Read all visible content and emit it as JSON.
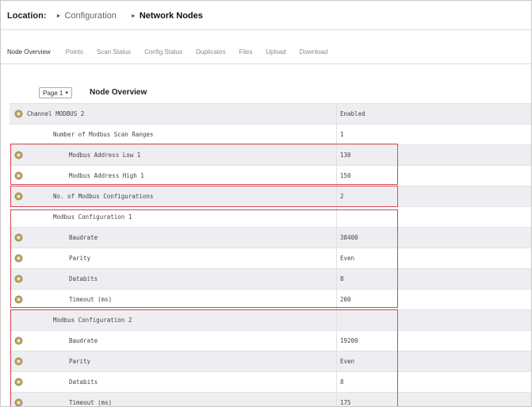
{
  "location": {
    "label": "Location:",
    "crumbs": [
      "Configuration",
      "Network Nodes"
    ]
  },
  "tabs": [
    "Node Overview",
    "Points",
    "Scan Status",
    "Config Status",
    "Duplicates",
    "Files",
    "Upload",
    "Download"
  ],
  "page_select": {
    "value": "Page 1"
  },
  "page_title": "Node Overview",
  "rows": [
    {
      "name": "Channel MODBUS 2",
      "value": "Enabled",
      "indent": 0,
      "icon": "gear-icon"
    },
    {
      "name": "Number of Modbus Scan Ranges",
      "value": "1",
      "indent": 1,
      "icon": ""
    },
    {
      "name": "Modbus Address Low 1",
      "value": "130",
      "indent": 2,
      "icon": "gear-icon"
    },
    {
      "name": "Modbus Address High 1",
      "value": "150",
      "indent": 2,
      "icon": "gear-icon"
    },
    {
      "name": "No. of Modbus Configurations",
      "value": "2",
      "indent": 1,
      "icon": "gear-icon"
    },
    {
      "name": "Modbus Configuration 1",
      "value": "",
      "indent": 1,
      "icon": ""
    },
    {
      "name": "Baudrate",
      "value": "38400",
      "indent": 2,
      "icon": "gear-icon"
    },
    {
      "name": "Parity",
      "value": "Even",
      "indent": 2,
      "icon": "gear-icon"
    },
    {
      "name": "Databits",
      "value": "8",
      "indent": 2,
      "icon": "gear-icon"
    },
    {
      "name": "Timeout (ms)",
      "value": "200",
      "indent": 2,
      "icon": "gear-icon"
    },
    {
      "name": "Modbus Configuration 2",
      "value": "",
      "indent": 1,
      "icon": ""
    },
    {
      "name": "Baudrate",
      "value": "19200",
      "indent": 2,
      "icon": "gear-icon"
    },
    {
      "name": "Parity",
      "value": "Even",
      "indent": 2,
      "icon": "gear-icon"
    },
    {
      "name": "Databits",
      "value": "8",
      "indent": 2,
      "icon": "gear-icon"
    },
    {
      "name": "Timeout (ms)",
      "value": "175",
      "indent": 2,
      "icon": "gear-icon"
    }
  ],
  "colors": {
    "highlight": "#d9474f",
    "row_shade": "#eeeef2",
    "gear": "#c9b27a"
  }
}
